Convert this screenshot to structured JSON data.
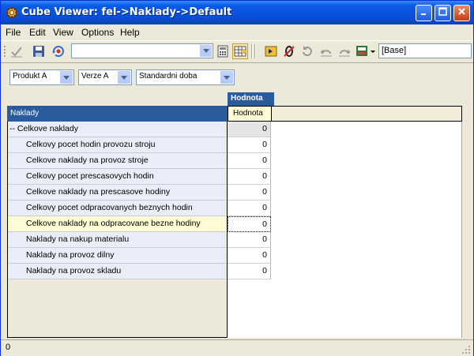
{
  "window": {
    "title": "Cube Viewer: fel->Naklady->Default"
  },
  "title_buttons": {
    "minimize": "_",
    "maximize": "□",
    "close": "✕"
  },
  "menu": [
    {
      "label": "File"
    },
    {
      "label": "Edit"
    },
    {
      "label": "View"
    },
    {
      "label": "Options"
    },
    {
      "label": "Help"
    }
  ],
  "toolbar": {
    "view_combo_value": "",
    "view_name_value": "[Base]",
    "icons": [
      "checkmark-icon",
      "save-icon",
      "recalc-icon",
      "calculator-icon",
      "spreadsheet-icon",
      "arrow-right-icon",
      "zero-suppress-icon",
      "refresh-icon",
      "undo-icon",
      "redo-icon",
      "export-icon"
    ]
  },
  "dimensions": [
    {
      "value": "Produkt A"
    },
    {
      "value": "Verze A"
    },
    {
      "value": "Standardni doba"
    }
  ],
  "grid": {
    "column_title": "Hodnota",
    "column_header": "Hodnota",
    "row_title": "Naklady",
    "rows": [
      {
        "label": "-- Celkove naklady",
        "value": "0"
      },
      {
        "label": "Celkovy pocet hodin provozu stroju",
        "value": "0"
      },
      {
        "label": "Celkove naklady na provoz stroje",
        "value": "0"
      },
      {
        "label": "Celkovy pocet prescasovych hodin",
        "value": "0"
      },
      {
        "label": "Celkove naklady na prescasove hodiny",
        "value": "0"
      },
      {
        "label": "Celkovy pocet odpracovanych beznych hodin",
        "value": "0"
      },
      {
        "label": "Celkove naklady na odpracovane bezne hodiny",
        "value": "0"
      },
      {
        "label": "Naklady na nakup materialu",
        "value": "0"
      },
      {
        "label": "Naklady na provoz dilny",
        "value": "0"
      },
      {
        "label": "Naklady na provoz skladu",
        "value": "0"
      }
    ],
    "selected_row": 6
  },
  "status": {
    "text": "0"
  }
}
